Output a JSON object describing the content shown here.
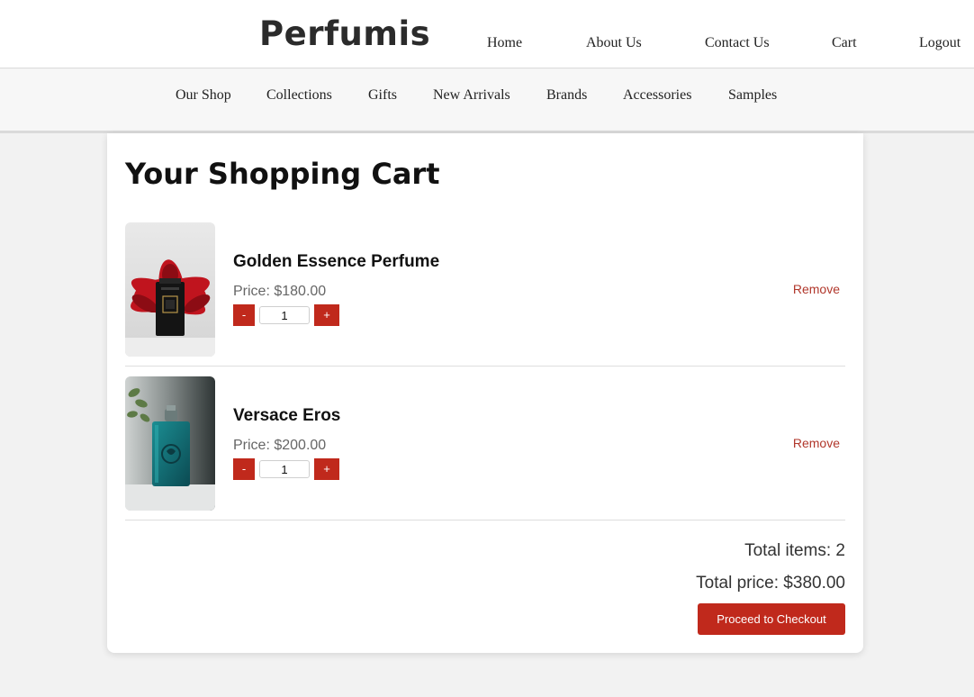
{
  "brand": {
    "name": "Perfumis"
  },
  "top_nav": {
    "items": [
      {
        "label": "Home"
      },
      {
        "label": "About Us"
      },
      {
        "label": "Contact Us"
      },
      {
        "label": "Cart"
      },
      {
        "label": "Logout"
      }
    ]
  },
  "sub_nav": {
    "items": [
      {
        "label": "Our Shop"
      },
      {
        "label": "Collections"
      },
      {
        "label": "Gifts"
      },
      {
        "label": "New Arrivals"
      },
      {
        "label": "Brands"
      },
      {
        "label": "Accessories"
      },
      {
        "label": "Samples"
      }
    ]
  },
  "cart": {
    "title": "Your Shopping Cart",
    "items": [
      {
        "name": "Golden Essence Perfume",
        "price": "Price: $180.00",
        "quantity": "1",
        "decrement_label": "-",
        "increment_label": "+",
        "remove_label": "Remove",
        "image": "black-perfume-bottle-with-red-flowers"
      },
      {
        "name": "Versace Eros",
        "price": "Price: $200.00",
        "quantity": "1",
        "decrement_label": "-",
        "increment_label": "+",
        "remove_label": "Remove",
        "image": "teal-perfume-bottle"
      }
    ],
    "total_items": "Total items: 2",
    "total_price": "Total price: $380.00",
    "checkout_label": "Proceed to Checkout"
  },
  "colors": {
    "accent": "#c0291c",
    "remove_link": "#b1372b",
    "page_background": "#f2f2f2"
  }
}
